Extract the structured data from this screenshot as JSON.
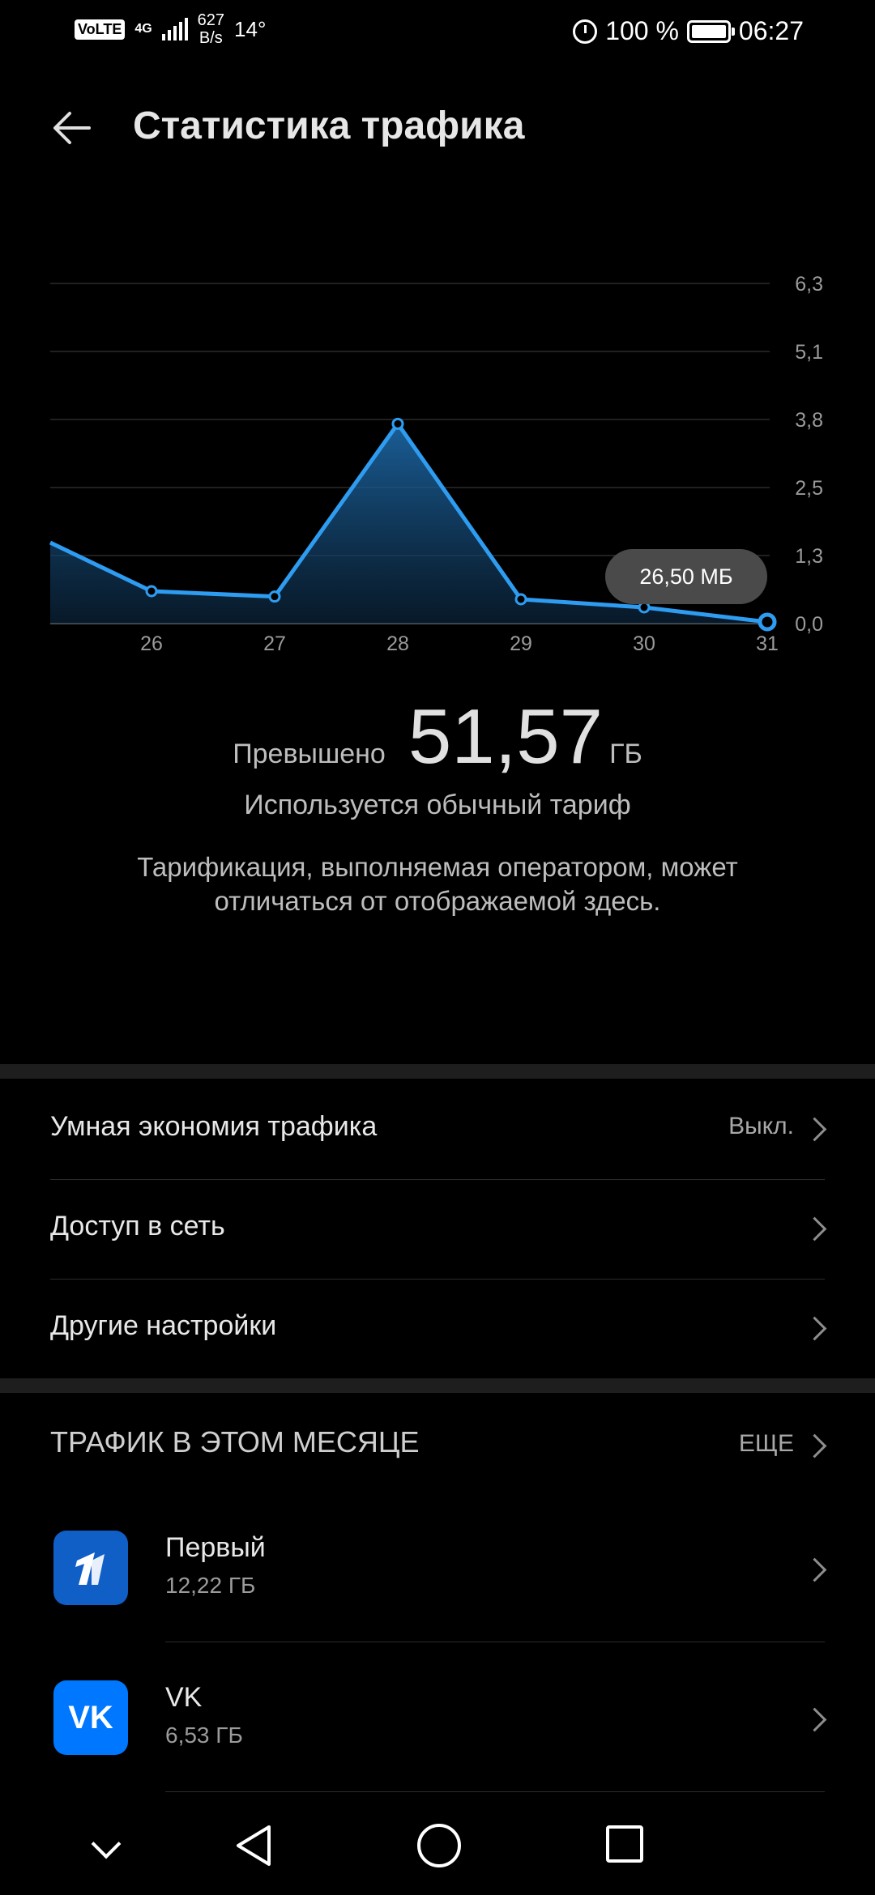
{
  "status_bar": {
    "volte": "VoLTE",
    "network": "4G",
    "speed_value": "627",
    "speed_unit": "B/s",
    "temperature": "14°",
    "battery": "100 %",
    "time": "06:27"
  },
  "header": {
    "title": "Статистика трафика"
  },
  "chart_data": {
    "type": "area",
    "x": [
      "",
      "26",
      "27",
      "28",
      "29",
      "30",
      "31"
    ],
    "y": [
      1.5,
      0.6,
      0.5,
      3.7,
      0.45,
      0.3,
      0.03
    ],
    "y_ticks": [
      "6,3",
      "5,1",
      "3,8",
      "2,5",
      "1,3",
      "0,0"
    ],
    "ylim": [
      0,
      6.3
    ],
    "grid": true,
    "tooltip": "26,50 МБ",
    "line_color": "#2e9cf0"
  },
  "summary": {
    "exceeded_label": "Превышено",
    "exceeded_value": "51,57",
    "exceeded_unit": "ГБ",
    "tariff": "Используется обычный тариф",
    "note": "Тарификация, выполняемая оператором, может отличаться от отображаемой здесь."
  },
  "settings": [
    {
      "label": "Умная экономия трафика",
      "value": "Выкл."
    },
    {
      "label": "Доступ в сеть",
      "value": ""
    },
    {
      "label": "Другие настройки",
      "value": ""
    }
  ],
  "monthly": {
    "title": "ТРАФИК В ЭТОМ МЕСЯЦЕ",
    "more": "ЕЩЕ",
    "apps": [
      {
        "name": "Первый",
        "size": "12,22 ГБ",
        "icon": "channel-one-icon",
        "icon_text": "1",
        "color": "#0f5fc6"
      },
      {
        "name": "VK",
        "size": "6,53 ГБ",
        "icon": "vk-icon",
        "icon_text": "VK",
        "color": "#0077ff"
      }
    ]
  }
}
